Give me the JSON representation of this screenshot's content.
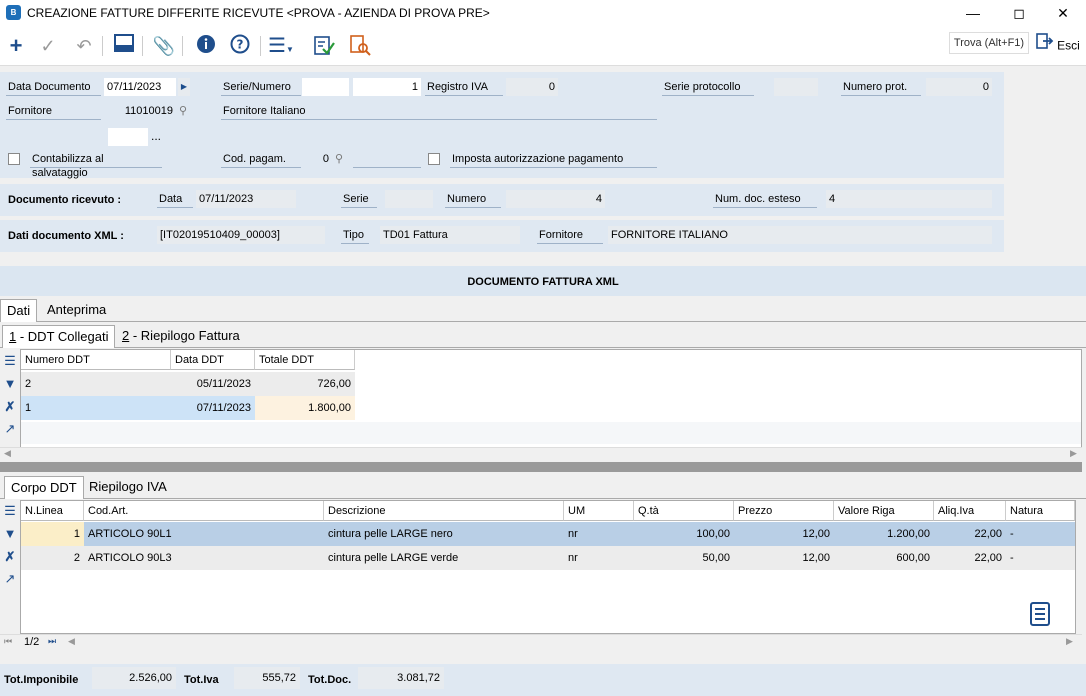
{
  "window": {
    "title": "CREAZIONE FATTURE DIFFERITE RICEVUTE <PROVA - AZIENDA DI PROVA PRE>",
    "app_icon": "B"
  },
  "toolbar": {
    "find_label": "Trova (Alt+F1)",
    "exit_label": "Esci"
  },
  "form": {
    "data_documento_label": "Data Documento",
    "data_documento": "07/11/2023",
    "serie_numero_label": "Serie/Numero",
    "serie": "",
    "numero": "1",
    "registro_iva_label": "Registro IVA",
    "registro_iva": "0",
    "serie_protocollo_label": "Serie protocollo",
    "serie_protocollo": "",
    "numero_prot_label": "Numero prot.",
    "numero_prot": "0",
    "fornitore_label": "Fornitore",
    "fornitore_code": "11010019",
    "fornitore_name": "Fornitore Italiano",
    "extra_field": "",
    "ellipsis": "...",
    "contabilizza_label": "Contabilizza al salvataggio",
    "cod_pagam_label": "Cod. pagam.",
    "cod_pagam": "0",
    "imposta_label": "Imposta autorizzazione pagamento"
  },
  "doc_ricevuto": {
    "label": "Documento ricevuto :",
    "data_label": "Data",
    "data": "07/11/2023",
    "serie_label": "Serie",
    "serie": "",
    "numero_label": "Numero",
    "numero": "4",
    "num_esteso_label": "Num. doc. esteso",
    "num_esteso": "4"
  },
  "doc_xml": {
    "label": "Dati documento XML :",
    "id": "[IT02019510409_00003]",
    "tipo_label": "Tipo",
    "tipo": "TD01 Fattura",
    "fornitore_label": "Fornitore",
    "fornitore": "FORNITORE ITALIANO"
  },
  "section_title": "DOCUMENTO FATTURA XML",
  "tabs": {
    "dati": "Dati",
    "anteprima": "Anteprima",
    "ddt_collegati_num": "1",
    "ddt_collegati": " - DDT Collegati",
    "riepilogo_num": "2",
    "riepilogo": " - Riepilogo Fattura",
    "corpo_ddt": "Corpo DDT",
    "riepilogo_iva": "Riepilogo IVA"
  },
  "ddt_grid": {
    "headers": [
      "Numero DDT",
      "Data DDT",
      "Totale DDT"
    ],
    "rows": [
      [
        "2",
        "05/11/2023",
        "726,00"
      ],
      [
        "1",
        "07/11/2023",
        "1.800,00"
      ]
    ]
  },
  "corpo_grid": {
    "headers": [
      "N.Linea",
      "Cod.Art.",
      "Descrizione",
      "UM",
      "Q.tà",
      "Prezzo",
      "Valore Riga",
      "Aliq.Iva",
      "Natura"
    ],
    "rows": [
      [
        "1",
        "ARTICOLO 90L1",
        "cintura pelle LARGE nero",
        "nr",
        "100,00",
        "12,00",
        "1.200,00",
        "22,00",
        "-"
      ],
      [
        "2",
        "ARTICOLO 90L3",
        "cintura pelle LARGE verde",
        "nr",
        "50,00",
        "12,00",
        "600,00",
        "22,00",
        "-"
      ]
    ],
    "pager": "1/2"
  },
  "totals": {
    "imponibile_label": "Tot.Imponibile",
    "imponibile": "2.526,00",
    "iva_label": "Tot.Iva",
    "iva": "555,72",
    "doc_label": "Tot.Doc.",
    "doc": "3.081,72"
  }
}
